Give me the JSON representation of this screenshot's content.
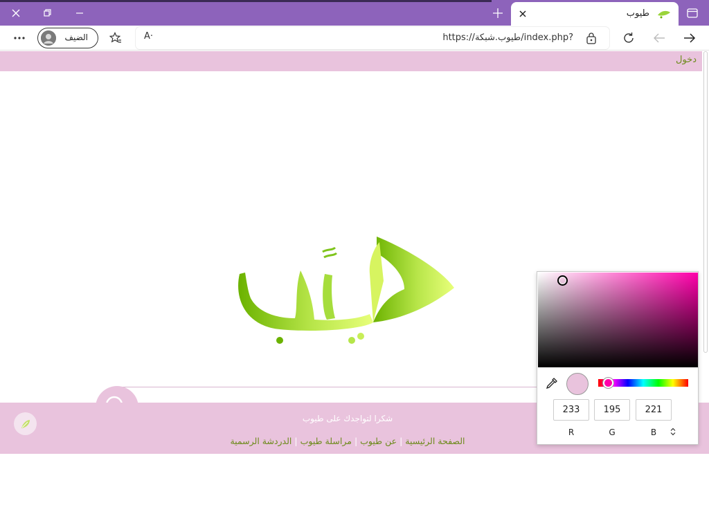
{
  "browser": {
    "tab_title": "طيوب",
    "guest_label": "الضيف",
    "url": "https://طيوب.شبكة/index.php?",
    "read_aloud_glyph": "A·"
  },
  "page": {
    "login_label": "دخول",
    "footer": {
      "thanks": "شكرا لتواجدك على طيوب",
      "links": [
        "الصفحة الرئيسية",
        "عن طيوب",
        "مراسلة طيوب",
        "الدردشة الرسمية"
      ],
      "separator": "|"
    }
  },
  "color_picker": {
    "selected_color": "#e9c3dd",
    "r": "233",
    "g": "195",
    "b": "221",
    "labels": {
      "r": "R",
      "g": "G",
      "b": "B"
    },
    "mode_toggle": "⌃⌄"
  },
  "colors": {
    "titlebar": "#8d63bb",
    "accent_pink": "#e9c3dd",
    "link_green": "#6c8a1a",
    "logo_green_dark": "#6bb200",
    "logo_green_light": "#e8ff7a"
  }
}
